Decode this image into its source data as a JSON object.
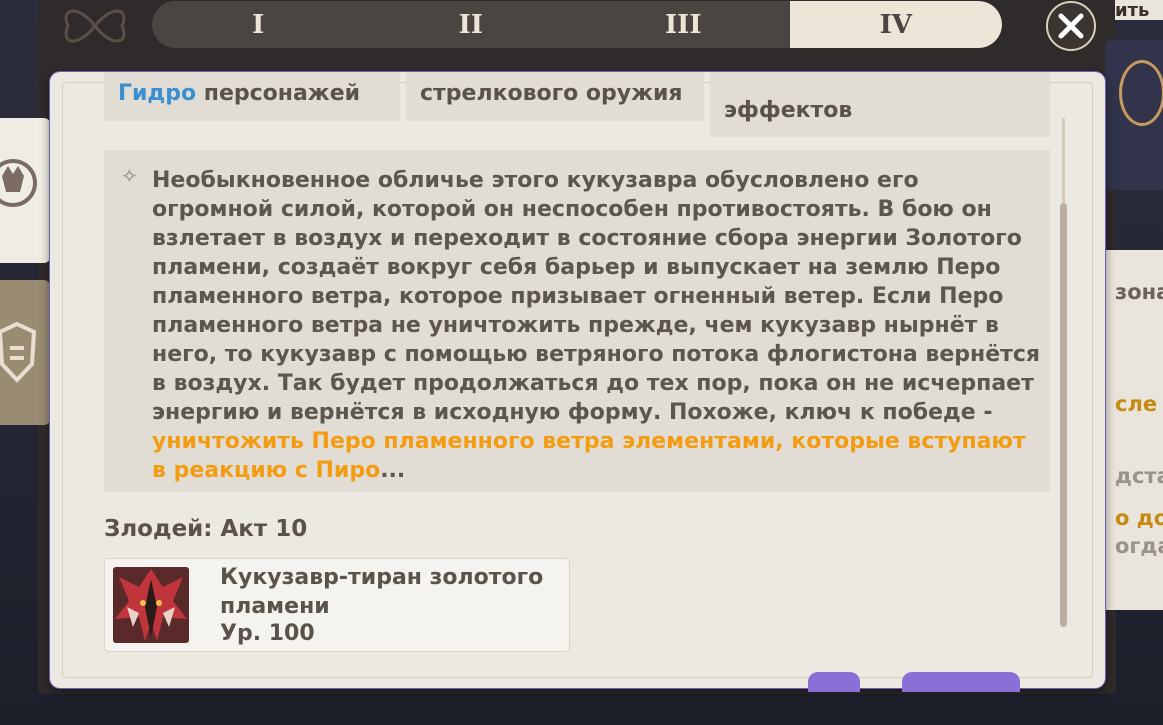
{
  "tabs": [
    {
      "label": "I",
      "active": false
    },
    {
      "label": "II",
      "active": false
    },
    {
      "label": "III",
      "active": false
    },
    {
      "label": "IV",
      "active": true
    }
  ],
  "close_icon": "close-icon",
  "chips": [
    {
      "label_highlight": "Гидро",
      "label_rest": " персонажей"
    },
    {
      "label_highlight": "",
      "label_rest": "стрелкового оружия"
    },
    {
      "label_highlight": "",
      "label_rest": "эффектов"
    }
  ],
  "description": {
    "text_main": "Необыкновенное обличье этого кукузавра обусловлено его огромной силой, которой он неспособен противостоять. В бою он взлетает в воздух и переходит в состояние сбора энергии Золотого пламени, создаёт вокруг себя барьер и выпускает на землю Перо пламенного ветра, которое призывает огненный ветер. Если Перо пламенного ветра не уничтожить прежде, чем кукузавр нырнёт в него, то кукузавр с помощью ветряного потока флогистона вернётся в воздух. Так будет продолжаться до тех пор, пока он не исчерпает энергию и вернётся в исходную форму. Похоже, ключ к победе - ",
    "text_highlight": "уничтожить Перо пламенного ветра элементами, которые вступают в реакцию с Пиро",
    "text_end": "..."
  },
  "villain": {
    "title": "Злодей: Акт 10",
    "enemy_name": "Кукузавр-тиран золотого пламени",
    "enemy_level": "Ур. 100"
  },
  "background_right": {
    "top_fragment": "ить",
    "lines": [
      "зона",
      "сле",
      "дста",
      "о до",
      "огда"
    ]
  },
  "colors": {
    "highlight_orange": "#f39c12",
    "highlight_blue": "#3a8fd1",
    "panel_bg": "#ece9e2",
    "text": "#5c5550"
  }
}
